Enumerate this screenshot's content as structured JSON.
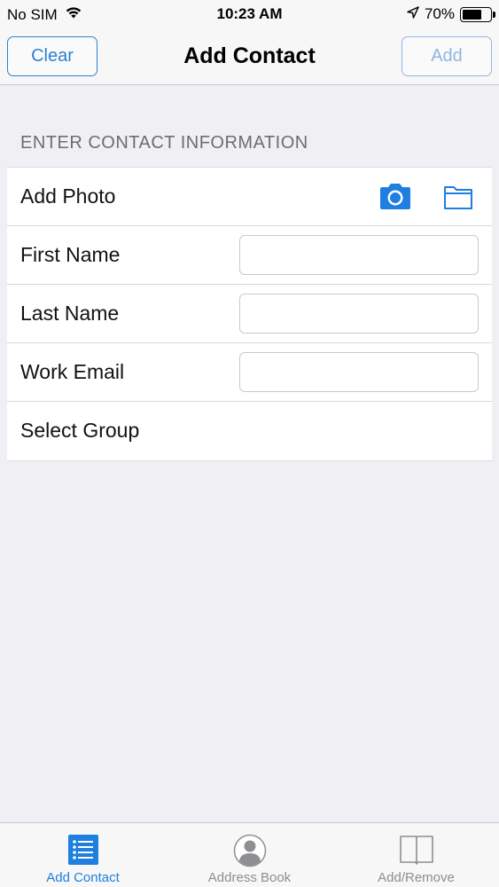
{
  "status_bar": {
    "carrier": "No SIM",
    "time": "10:23 AM",
    "battery_percent": "70%",
    "battery_level": 0.7
  },
  "nav": {
    "clear_label": "Clear",
    "title": "Add Contact",
    "add_label": "Add"
  },
  "section": {
    "header": "ENTER CONTACT INFORMATION"
  },
  "form": {
    "add_photo_label": "Add Photo",
    "first_name_label": "First Name",
    "first_name_value": "",
    "last_name_label": "Last Name",
    "last_name_value": "",
    "work_email_label": "Work Email",
    "work_email_value": "",
    "select_group_label": "Select Group"
  },
  "tabs": [
    {
      "label": "Add Contact",
      "icon": "list-icon",
      "active": true
    },
    {
      "label": "Address Book",
      "icon": "person-icon",
      "active": false
    },
    {
      "label": "Add/Remove",
      "icon": "book-icon",
      "active": false
    }
  ],
  "colors": {
    "accent": "#2f80d1",
    "tab_active": "#1e7fe0",
    "disabled": "#8fb6e3"
  }
}
